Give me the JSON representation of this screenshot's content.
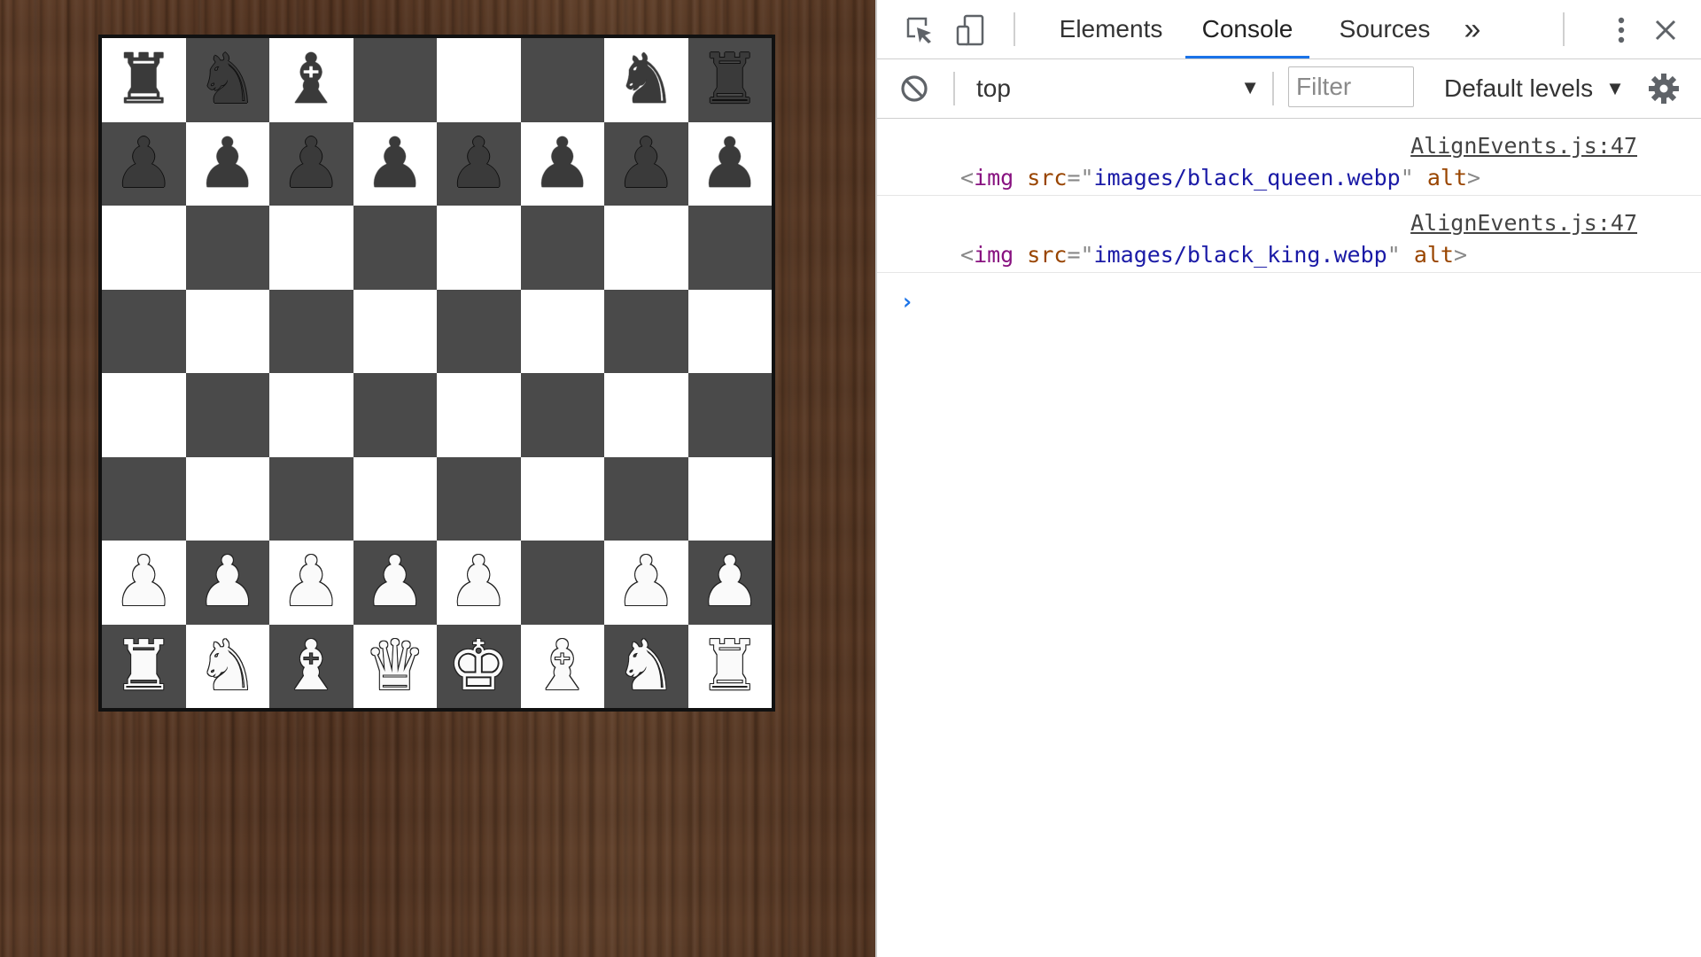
{
  "board": {
    "rows": [
      [
        {
          "p": "♜",
          "c": "black",
          "name": "black-rook-icon"
        },
        {
          "p": "♞",
          "c": "black",
          "name": "black-knight-icon"
        },
        {
          "p": "♝",
          "c": "black",
          "name": "black-bishop-icon"
        },
        {
          "p": "",
          "c": "",
          "name": ""
        },
        {
          "p": "",
          "c": "",
          "name": ""
        },
        {
          "p": "",
          "c": "",
          "name": ""
        },
        {
          "p": "♞",
          "c": "black",
          "name": "black-knight-icon"
        },
        {
          "p": "♜",
          "c": "black",
          "name": "black-rook-icon"
        }
      ],
      [
        {
          "p": "♟",
          "c": "black",
          "name": "black-pawn-icon"
        },
        {
          "p": "♟",
          "c": "black",
          "name": "black-pawn-icon"
        },
        {
          "p": "♟",
          "c": "black",
          "name": "black-pawn-icon"
        },
        {
          "p": "♟",
          "c": "black",
          "name": "black-pawn-icon"
        },
        {
          "p": "♟",
          "c": "black",
          "name": "black-pawn-icon"
        },
        {
          "p": "♟",
          "c": "black",
          "name": "black-pawn-icon"
        },
        {
          "p": "♟",
          "c": "black",
          "name": "black-pawn-icon"
        },
        {
          "p": "♟",
          "c": "black",
          "name": "black-pawn-icon"
        }
      ],
      [
        {
          "p": "",
          "c": "",
          "name": ""
        },
        {
          "p": "",
          "c": "",
          "name": ""
        },
        {
          "p": "",
          "c": "",
          "name": ""
        },
        {
          "p": "",
          "c": "",
          "name": ""
        },
        {
          "p": "",
          "c": "",
          "name": ""
        },
        {
          "p": "",
          "c": "",
          "name": ""
        },
        {
          "p": "",
          "c": "",
          "name": ""
        },
        {
          "p": "",
          "c": "",
          "name": ""
        }
      ],
      [
        {
          "p": "",
          "c": "",
          "name": ""
        },
        {
          "p": "",
          "c": "",
          "name": ""
        },
        {
          "p": "",
          "c": "",
          "name": ""
        },
        {
          "p": "",
          "c": "",
          "name": ""
        },
        {
          "p": "",
          "c": "",
          "name": ""
        },
        {
          "p": "",
          "c": "",
          "name": ""
        },
        {
          "p": "",
          "c": "",
          "name": ""
        },
        {
          "p": "",
          "c": "",
          "name": ""
        }
      ],
      [
        {
          "p": "",
          "c": "",
          "name": ""
        },
        {
          "p": "",
          "c": "",
          "name": ""
        },
        {
          "p": "",
          "c": "",
          "name": ""
        },
        {
          "p": "",
          "c": "",
          "name": ""
        },
        {
          "p": "",
          "c": "",
          "name": ""
        },
        {
          "p": "",
          "c": "",
          "name": ""
        },
        {
          "p": "",
          "c": "",
          "name": ""
        },
        {
          "p": "",
          "c": "",
          "name": ""
        }
      ],
      [
        {
          "p": "",
          "c": "",
          "name": ""
        },
        {
          "p": "",
          "c": "",
          "name": ""
        },
        {
          "p": "",
          "c": "",
          "name": ""
        },
        {
          "p": "",
          "c": "",
          "name": ""
        },
        {
          "p": "",
          "c": "",
          "name": ""
        },
        {
          "p": "",
          "c": "",
          "name": ""
        },
        {
          "p": "",
          "c": "",
          "name": ""
        },
        {
          "p": "",
          "c": "",
          "name": ""
        }
      ],
      [
        {
          "p": "♟",
          "c": "white",
          "name": "white-pawn-icon"
        },
        {
          "p": "♟",
          "c": "white",
          "name": "white-pawn-icon"
        },
        {
          "p": "♟",
          "c": "white",
          "name": "white-pawn-icon"
        },
        {
          "p": "♟",
          "c": "white",
          "name": "white-pawn-icon"
        },
        {
          "p": "♟",
          "c": "white",
          "name": "white-pawn-icon"
        },
        {
          "p": "",
          "c": "",
          "name": ""
        },
        {
          "p": "♟",
          "c": "white",
          "name": "white-pawn-icon"
        },
        {
          "p": "♟",
          "c": "white",
          "name": "white-pawn-icon"
        }
      ],
      [
        {
          "p": "♜",
          "c": "white",
          "name": "white-rook-icon"
        },
        {
          "p": "♞",
          "c": "white",
          "name": "white-knight-icon"
        },
        {
          "p": "♝",
          "c": "white",
          "name": "white-bishop-icon"
        },
        {
          "p": "♛",
          "c": "white",
          "name": "white-queen-icon"
        },
        {
          "p": "♚",
          "c": "white",
          "name": "white-king-icon"
        },
        {
          "p": "♝",
          "c": "white",
          "name": "white-bishop-icon"
        },
        {
          "p": "♞",
          "c": "white",
          "name": "white-knight-icon"
        },
        {
          "p": "♜",
          "c": "white",
          "name": "white-rook-icon"
        }
      ]
    ],
    "colors": {
      "light": "#ffffff",
      "dark": "#4a4a4a"
    }
  },
  "devtools": {
    "tabs": [
      {
        "label": "Elements",
        "active": false
      },
      {
        "label": "Console",
        "active": true
      },
      {
        "label": "Sources",
        "active": false
      }
    ],
    "more_tabs": "»",
    "context": "top",
    "filter_placeholder": "Filter",
    "levels_label": "Default levels",
    "logs": [
      {
        "source": "AlignEvents.js:47",
        "tag": "img",
        "attr": "src",
        "value": "images/black_queen.webp",
        "attr2": "alt"
      },
      {
        "source": "AlignEvents.js:47",
        "tag": "img",
        "attr": "src",
        "value": "images/black_king.webp",
        "attr2": "alt"
      }
    ],
    "prompt": "›"
  }
}
